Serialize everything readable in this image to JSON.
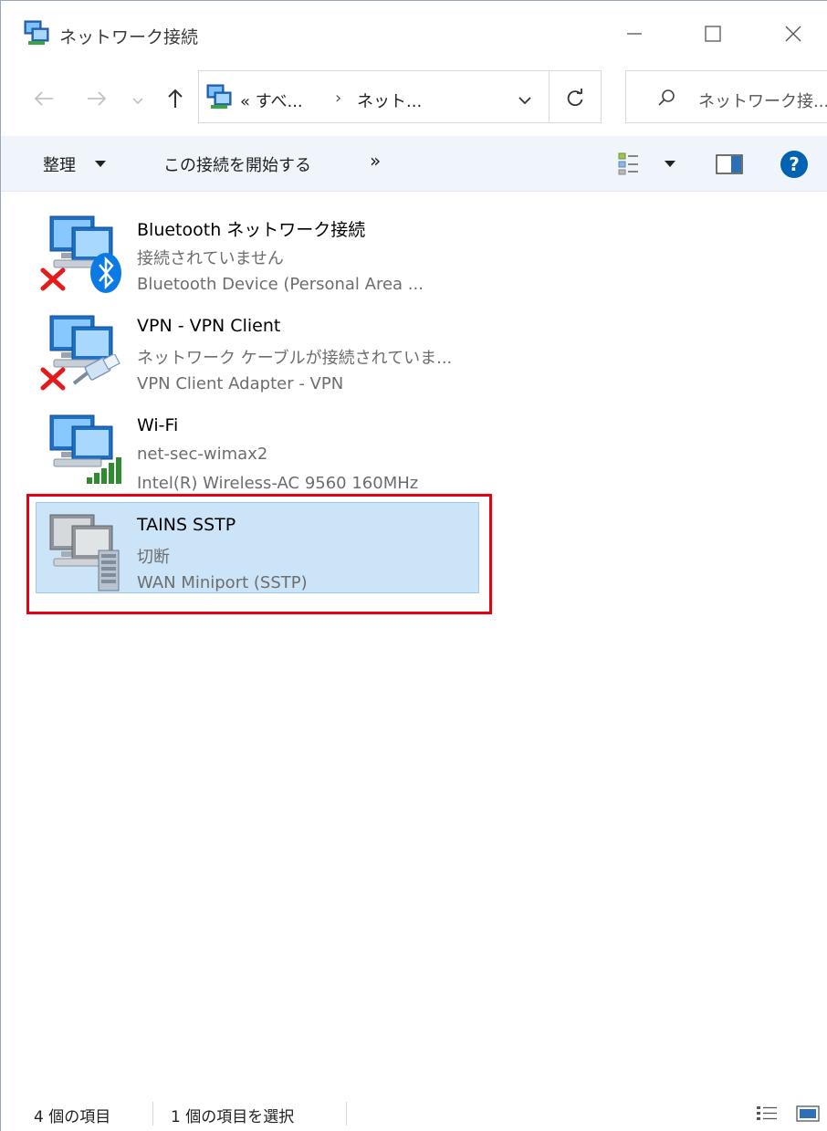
{
  "window": {
    "title": "ネットワーク接続",
    "minimize": "—",
    "maximize": "☐",
    "close": "✕"
  },
  "nav": {
    "back_icon": "←",
    "forward_icon": "→",
    "recent_icon": "⌄",
    "up_icon": "↑",
    "breadcrumb": [
      "« すべ...",
      "›",
      "ネット..."
    ],
    "dropdown_icon": "⌄",
    "refresh_icon": "↻",
    "search_placeholder": "ネットワーク接..."
  },
  "commands": {
    "organize": "整理",
    "start_connection": "この接続を開始する",
    "more": "»"
  },
  "connections": [
    {
      "name": "Bluetooth ネットワーク接続",
      "status": "接続されていません",
      "device": "Bluetooth Device (Personal Area ...",
      "badge": "bluetooth",
      "error": true
    },
    {
      "name": "VPN - VPN Client",
      "status": "ネットワーク ケーブルが接続されていま...",
      "device": "VPN Client Adapter - VPN",
      "badge": "cable",
      "error": true
    },
    {
      "name": "Wi-Fi",
      "status": "net-sec-wimax2",
      "device": "Intel(R) Wireless-AC 9560 160MHz",
      "badge": "signal",
      "error": false
    },
    {
      "name": "TAINS SSTP",
      "status": "切断",
      "device": "WAN Miniport (SSTP)",
      "badge": "server",
      "error": false,
      "selected": true
    }
  ],
  "statusbar": {
    "item_count": "4 個の項目",
    "selected_count": "1 個の項目を選択"
  },
  "colors": {
    "selection_bg": "#cce4f7",
    "selection_border": "#99c9ef",
    "highlight_frame": "#e60012",
    "help_blue": "#0063b1",
    "error_red": "#e21b1b",
    "wifi_green": "#2e8b2e"
  }
}
